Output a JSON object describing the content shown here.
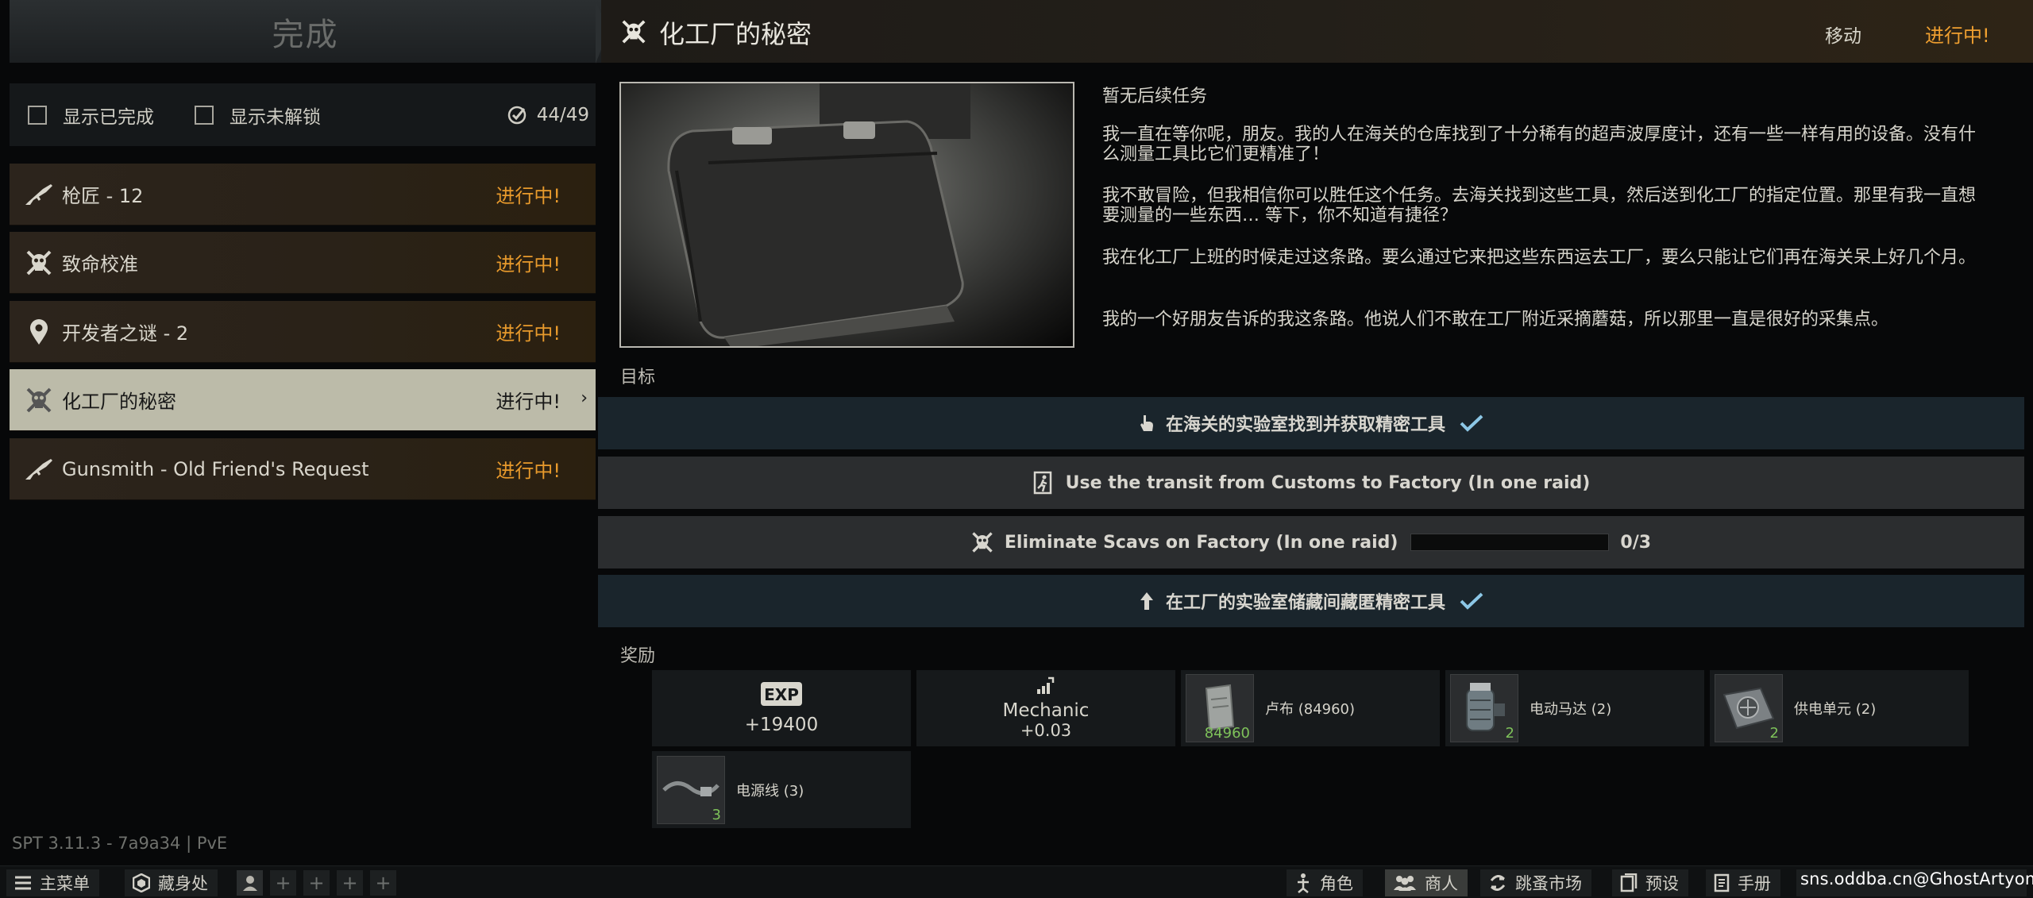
{
  "left": {
    "complete_label": "完成",
    "filters": {
      "show_completed": "显示已完成",
      "show_locked": "显示未解锁",
      "count": "44/49"
    },
    "quests": [
      {
        "name": "枪匠 - 12",
        "status": "进行中!",
        "icon": "rifle-icon"
      },
      {
        "name": "致命校准",
        "status": "进行中!",
        "icon": "skull-icon"
      },
      {
        "name": "开发者之谜 - 2",
        "status": "进行中!",
        "icon": "map-pin-icon"
      },
      {
        "name": "化工厂的秘密",
        "status": "进行中!",
        "icon": "skull-icon",
        "selected": true
      },
      {
        "name": "Gunsmith - Old Friend's Request",
        "status": "进行中!",
        "icon": "rifle-icon"
      }
    ],
    "version": "SPT 3.11.3 - 7a9a34 | PvE"
  },
  "header": {
    "title": "化工厂的秘密",
    "move_label": "移动",
    "status": "进行中!"
  },
  "detail": {
    "no_followup": "暂无后续任务",
    "paragraphs": [
      "我一直在等你呢，朋友。我的人在海关的仓库找到了十分稀有的超声波厚度计，还有一些一样有用的设备。没有什么测量工具比它们更精准了！",
      "我不敢冒险，但我相信你可以胜任这个任务。去海关找到这些工具，然后送到化工厂的指定位置。那里有我一直想要测量的一些东西… 等下，你不知道有捷径？",
      "我在化工厂上班的时候走过这条路。要么通过它来把这些东西运去工厂，要么只能让它们再在海关呆上好几个月。",
      "我的一个好朋友告诉的我这条路。他说人们不敢在工厂附近采摘蘑菇，所以那里一直是很好的采集点。"
    ],
    "objectives_label": "目标",
    "objectives": [
      {
        "text": "在海关的实验室找到并获取精密工具",
        "done": true,
        "icon": "hand-pointer-icon"
      },
      {
        "text": "Use the transit from Customs to Factory (In one raid)",
        "done": false,
        "icon": "exit-door-icon"
      },
      {
        "text": "Eliminate Scavs on Factory (In one raid)",
        "done": false,
        "icon": "skull-icon",
        "progress": "0/3",
        "progress_value": 0
      },
      {
        "text": "在工厂的实验室储藏间藏匿精密工具",
        "done": true,
        "icon": "arrow-up-icon"
      }
    ],
    "rewards_label": "奖励",
    "rewards": {
      "exp_badge": "EXP",
      "exp_value": "+19400",
      "trader_name": "Mechanic",
      "trader_value": "+0.03",
      "items": [
        {
          "name": "卢布 (84960)",
          "qty": "84960",
          "icon": "roubles-icon"
        },
        {
          "name": "电动马达 (2)",
          "qty": "2",
          "icon": "electric-motor-icon"
        },
        {
          "name": "供电单元 (2)",
          "qty": "2",
          "icon": "power-supply-icon"
        },
        {
          "name": "电源线 (3)",
          "qty": "3",
          "icon": "power-cord-icon"
        }
      ]
    }
  },
  "bottom": {
    "main_menu": "主菜单",
    "hideout": "藏身处",
    "character": "角色",
    "traders": "商人",
    "flea_market": "跳蚤市场",
    "presets": "预设",
    "handbook": "手册",
    "plus": "+",
    "watermark": "sns.oddba.cn@GhostArtyom"
  },
  "colors": {
    "accent_orange": "#e89a2c",
    "selected_bg": "#bcbba9",
    "done_objective_bg": "#1a252c",
    "check_blue": "#8cc7e6",
    "qty_green": "#7ec25a"
  }
}
